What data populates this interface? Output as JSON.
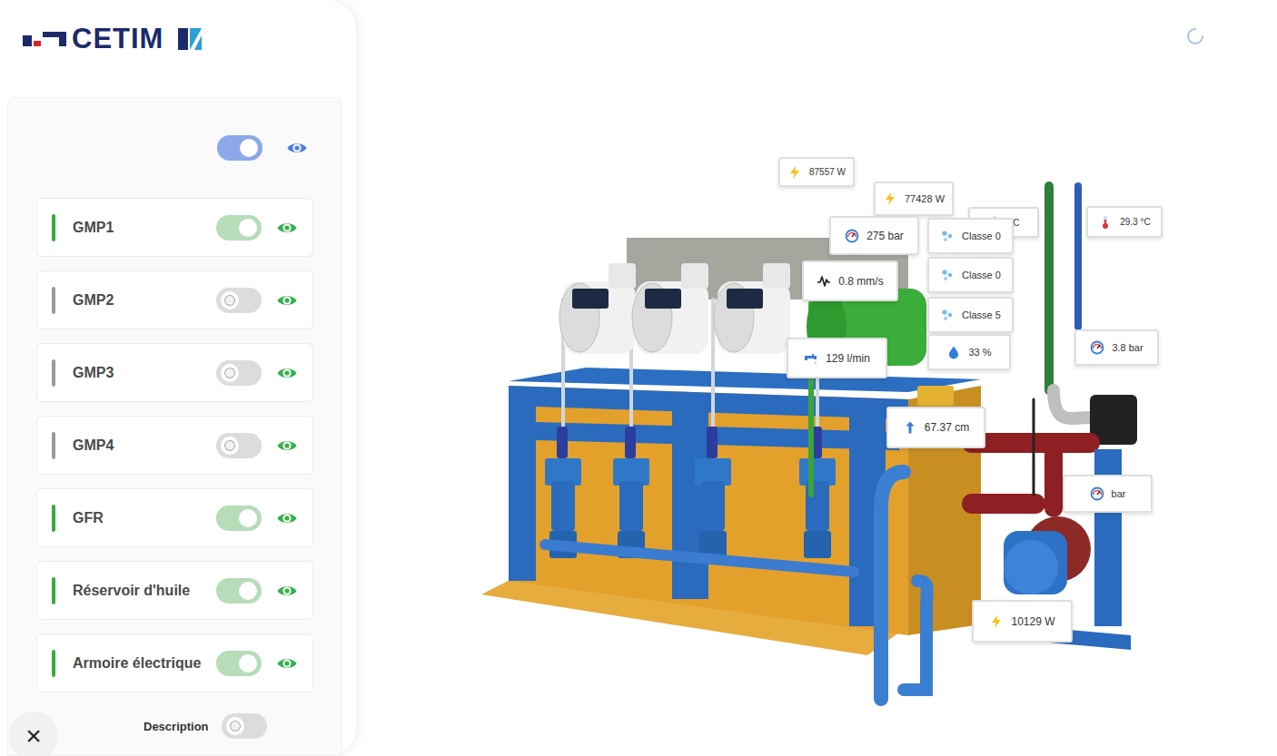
{
  "logo": {
    "text": "CETIM"
  },
  "layers": {
    "master": {
      "on": true,
      "visible": true
    },
    "items": [
      {
        "label": "GMP1",
        "on": true,
        "visible": true,
        "color": "#3aaa3c"
      },
      {
        "label": "GMP2",
        "on": false,
        "visible": true,
        "color": "#9a9a9a"
      },
      {
        "label": "GMP3",
        "on": false,
        "visible": true,
        "color": "#9a9a9a"
      },
      {
        "label": "GMP4",
        "on": false,
        "visible": true,
        "color": "#9a9a9a"
      },
      {
        "label": "GFR",
        "on": true,
        "visible": true,
        "color": "#3aaa3c"
      },
      {
        "label": "Réservoir d'huile",
        "on": true,
        "visible": true,
        "color": "#3aaa3c"
      },
      {
        "label": "Armoire électrique",
        "on": true,
        "visible": true,
        "color": "#3aaa3c"
      }
    ]
  },
  "description": {
    "label": "Description",
    "on": false
  },
  "close": {
    "icon": "×"
  },
  "sensors": [
    {
      "kind": "power",
      "text": "87557 W"
    },
    {
      "kind": "power",
      "text": "77428 W"
    },
    {
      "kind": "temperature",
      "text": "°C"
    },
    {
      "kind": "temperature",
      "text": "29.3 °C"
    },
    {
      "kind": "pressure",
      "text": "275 bar"
    },
    {
      "kind": "particles",
      "text": "Classe 0"
    },
    {
      "kind": "particles",
      "text": "Classe 0"
    },
    {
      "kind": "particles",
      "text": "Classe 5"
    },
    {
      "kind": "vibration",
      "text": "0.8 mm/s"
    },
    {
      "kind": "flow",
      "text": "129 l/min"
    },
    {
      "kind": "humidity",
      "text": "33 %"
    },
    {
      "kind": "pressure",
      "text": "3.8 bar"
    },
    {
      "kind": "level",
      "text": "67.37 cm"
    },
    {
      "kind": "pressure",
      "text": "bar"
    },
    {
      "kind": "power",
      "text": "10129 W"
    }
  ]
}
